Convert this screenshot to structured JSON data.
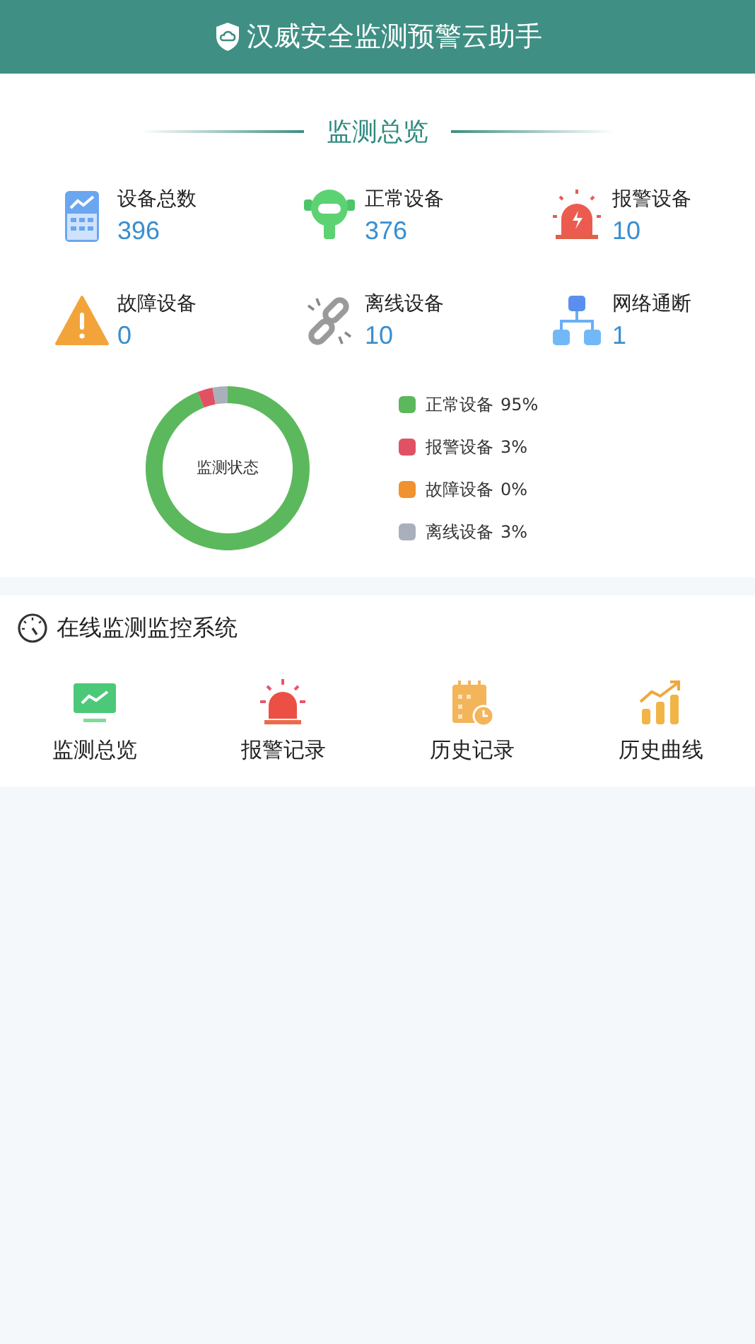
{
  "header": {
    "title": "汉威安全监测预警云助手"
  },
  "overview": {
    "title": "监测总览",
    "stats": [
      {
        "kind": "total",
        "label": "设备总数",
        "value": "396"
      },
      {
        "kind": "normal",
        "label": "正常设备",
        "value": "376"
      },
      {
        "kind": "alarm",
        "label": "报警设备",
        "value": "10"
      },
      {
        "kind": "fault",
        "label": "故障设备",
        "value": "0"
      },
      {
        "kind": "offline",
        "label": "离线设备",
        "value": "10"
      },
      {
        "kind": "network",
        "label": "网络通断",
        "value": "1"
      }
    ],
    "chart_data": {
      "type": "donut",
      "title": "监测状态",
      "categories": [
        "正常设备",
        "报警设备",
        "故障设备",
        "离线设备"
      ],
      "values": [
        95,
        3,
        0,
        3
      ]
    },
    "legend": [
      {
        "percent": "95%",
        "color": "#5cb85c"
      },
      {
        "percent": "3%",
        "color": "#e05263"
      },
      {
        "percent": "0%",
        "color": "#f0922f"
      },
      {
        "percent": "3%",
        "color": "#a9b0bc"
      }
    ]
  },
  "system": {
    "title": "在线监测监控系统",
    "items": [
      {
        "kind": "monitor",
        "label": "监测总览"
      },
      {
        "kind": "alarm",
        "label": "报警记录"
      },
      {
        "kind": "history",
        "label": "历史记录"
      },
      {
        "kind": "curve",
        "label": "历史曲线"
      }
    ]
  }
}
